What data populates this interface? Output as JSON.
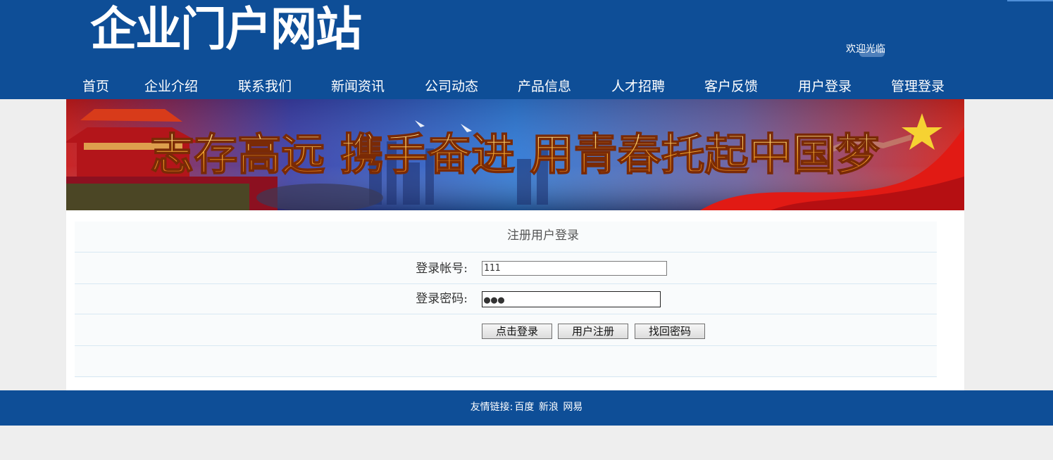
{
  "header": {
    "site_title": "企业门户网站",
    "welcome": "欢迎光临",
    "bg_color": "#0e4e97"
  },
  "nav": {
    "items": [
      "首页",
      "企业介绍",
      "联系我们",
      "新闻资讯",
      "公司动态",
      "产品信息",
      "人才招聘",
      "客户反馈",
      "用户登录",
      "管理登录"
    ]
  },
  "banner": {
    "slogan": "志存高远 携手奋进 用青春托起中国梦"
  },
  "login_form": {
    "title": "注册用户登录",
    "account_label": "登录帐号:",
    "account_value": "111",
    "password_label": "登录密码:",
    "password_value": "●●●",
    "buttons": {
      "login": "点击登录",
      "register": "用户注册",
      "recover": "找回密码"
    }
  },
  "footer": {
    "prefix": "友情链接:",
    "links": [
      "百度",
      "新浪",
      "网易"
    ]
  }
}
